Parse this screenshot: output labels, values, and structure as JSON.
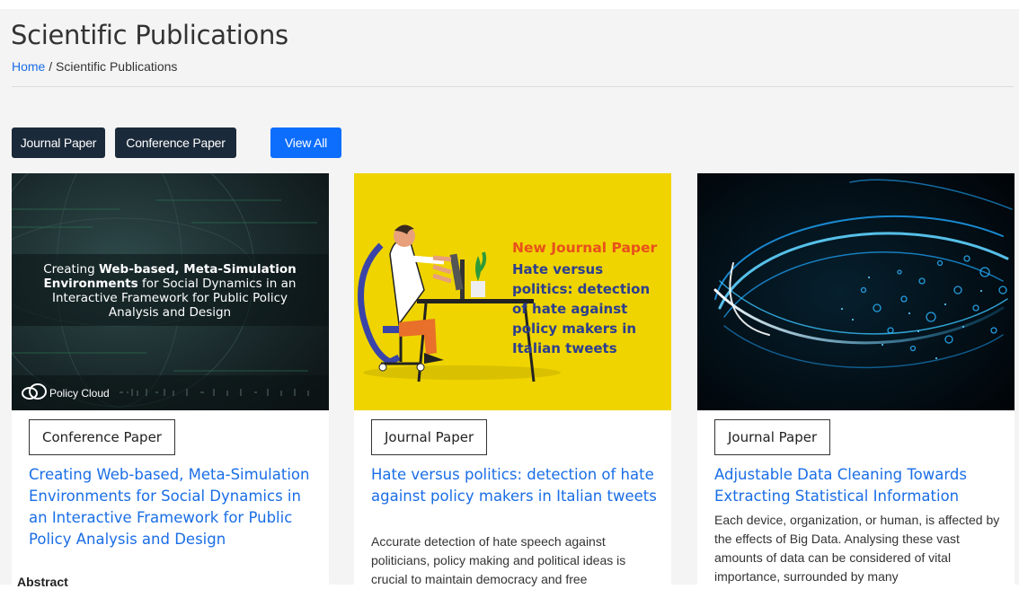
{
  "header": {
    "title": "Scientific Publications",
    "breadcrumb_home": "Home",
    "breadcrumb_sep": " / ",
    "breadcrumb_current": "Scientific Publications"
  },
  "filters": {
    "journal": "Journal Paper",
    "conference": "Conference Paper",
    "view_all": "View All"
  },
  "cards": [
    {
      "image": {
        "line1_pre": "Creating ",
        "line1_bold": "Web-based, Meta-Simulation",
        "line2_bold": "Environments",
        "line2_post": " for Social Dynamics in an",
        "line3": "Interactive Framework for Public Policy",
        "line4": "Analysis and Design",
        "logo": "Policy Cloud"
      },
      "badge": "Conference Paper",
      "title": "Creating Web-based, Meta-Simulation Environments for Social Dynamics in an Interactive Framework for Public Policy Analysis and Design",
      "abstract_label": "Abstract"
    },
    {
      "image": {
        "heading": "New Journal Paper",
        "lines": [
          "Hate versus",
          "politics: detection",
          "of hate against",
          "policy makers in",
          "Italian tweets"
        ]
      },
      "badge": "Journal Paper",
      "title": "Hate versus politics: detection of hate against policy makers in Italian tweets",
      "text": "Accurate detection of hate speech against politicians, policy making and political ideas is crucial to maintain democracy and free"
    },
    {
      "badge": "Journal Paper",
      "title": "Adjustable Data Cleaning Towards Extracting Statistical Information",
      "text": "Each device, organization, or human, is affected by the effects of Big Data. Analysing these vast amounts of data can be considered of vital importance, surrounded by many"
    }
  ],
  "colors": {
    "link": "#1a6ee6",
    "dark_button": "#1b2a3a",
    "primary_button": "#0d6efd",
    "card2_bg": "#efd400",
    "card2_heading": "#e8501c",
    "card2_text": "#2c3e8f"
  }
}
